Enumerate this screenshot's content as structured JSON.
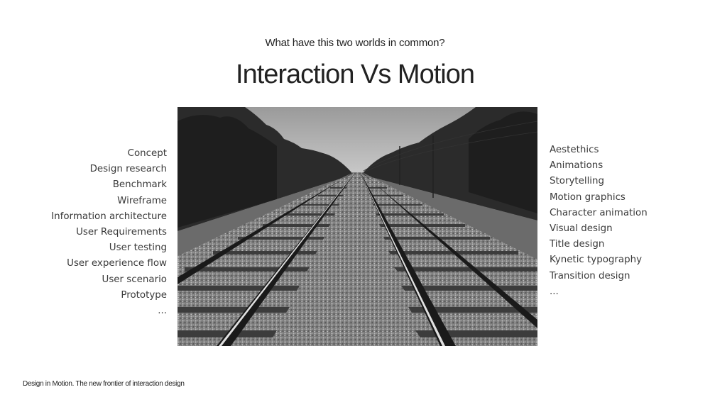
{
  "slide": {
    "subtitle": "What have this two worlds in common?",
    "title": "Interaction Vs Motion",
    "footer": "Design in Motion. The new frontier of interaction design",
    "interaction_items": [
      "Concept",
      "Design research",
      "Benchmark",
      "Wireframe",
      "Information architecture",
      "User Requirements",
      "User testing",
      "User experience flow",
      "User scenario",
      "Prototype",
      "..."
    ],
    "motion_items": [
      "Aestethics",
      "Animations",
      "Storytelling",
      "Motion graphics",
      "Character animation",
      "Visual design",
      "Title design",
      "Kynetic typography",
      "Transition design",
      "..."
    ]
  }
}
